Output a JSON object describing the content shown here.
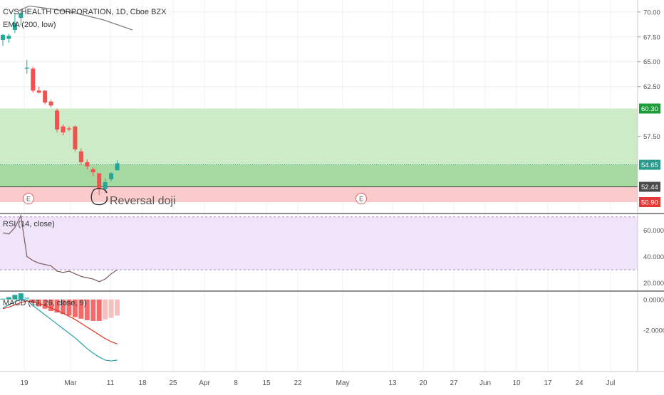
{
  "chart": {
    "title": "CVS HEALTH CORPORATION, 1D, Cboe BZX",
    "ema_label": "EMA (200, low)",
    "annotation": "Reversal doji",
    "earnings_marker": "E",
    "colors": {
      "up": "#26a69a",
      "down": "#ef5350",
      "ema": "#808080",
      "target_zone": "#cdebc6",
      "target_zone_dark": "#a5d9a0",
      "stop_zone": "#fbcaca",
      "price_badge": "#2a9a8c",
      "target_badge": "#1e9c3a",
      "entry_badge": "#4a4a4a",
      "rsi_band": "#f0e4fb",
      "rsi_line": "#7a5a5a",
      "macd_line": "#2aa0a8",
      "signal_line": "#e0321e",
      "hist_strong": "#f26b6b",
      "hist_weak": "#f7c0c0"
    },
    "price_axis": [
      "70.00",
      "67.50",
      "65.00",
      "62.50",
      "57.50"
    ],
    "badges": {
      "target": "60.30",
      "last": "54.65",
      "entry": "52.44",
      "stop": "50.90"
    },
    "rsi": {
      "label": "RSI (14, close)",
      "axis": [
        "60.0000",
        "40.0000",
        "20.0000"
      ]
    },
    "macd": {
      "label": "MACD (12, 26, close, 9)",
      "axis": [
        "0.0000",
        "-2.0000"
      ]
    },
    "x_axis": [
      "19",
      "Mar",
      "11",
      "18",
      "25",
      "Apr",
      "8",
      "15",
      "22",
      "May",
      "13",
      "20",
      "27",
      "Jun",
      "10",
      "17",
      "24",
      "Jul"
    ]
  },
  "chart_data": {
    "type": "candlestick",
    "title": "CVS HEALTH CORPORATION, 1D, Cboe BZX",
    "y_range": [
      49.9,
      71.2
    ],
    "candles": [
      {
        "o": 67.2,
        "h": 67.8,
        "l": 66.6,
        "c": 67.7
      },
      {
        "o": 67.3,
        "h": 67.8,
        "l": 66.9,
        "c": 67.6
      },
      {
        "o": 68.2,
        "h": 69.9,
        "l": 67.9,
        "c": 68.9
      },
      {
        "o": 69.4,
        "h": 70.2,
        "l": 68.6,
        "c": 69.9
      },
      {
        "o": 64.3,
        "h": 65.2,
        "l": 63.8,
        "c": 64.4
      },
      {
        "o": 64.3,
        "h": 64.5,
        "l": 61.9,
        "c": 62.1
      },
      {
        "o": 62.1,
        "h": 62.5,
        "l": 61.8,
        "c": 61.9
      },
      {
        "o": 62.1,
        "h": 62.1,
        "l": 60.7,
        "c": 60.9
      },
      {
        "o": 61.0,
        "h": 61.2,
        "l": 60.4,
        "c": 60.6
      },
      {
        "o": 60.1,
        "h": 60.3,
        "l": 57.9,
        "c": 58.2
      },
      {
        "o": 58.5,
        "h": 58.7,
        "l": 57.6,
        "c": 57.9
      },
      {
        "o": 58.3,
        "h": 58.5,
        "l": 58.0,
        "c": 58.2
      },
      {
        "o": 58.5,
        "h": 58.6,
        "l": 56.0,
        "c": 56.2
      },
      {
        "o": 56.0,
        "h": 56.3,
        "l": 54.6,
        "c": 54.9
      },
      {
        "o": 54.9,
        "h": 55.2,
        "l": 54.2,
        "c": 54.5
      },
      {
        "o": 54.2,
        "h": 54.4,
        "l": 53.5,
        "c": 53.9
      },
      {
        "o": 53.8,
        "h": 53.8,
        "l": 51.6,
        "c": 52.2
      },
      {
        "o": 52.2,
        "h": 53.3,
        "l": 51.8,
        "c": 52.9
      },
      {
        "o": 53.2,
        "h": 53.9,
        "l": 53.0,
        "c": 53.8
      },
      {
        "o": 54.1,
        "h": 55.1,
        "l": 54.1,
        "c": 54.8
      }
    ],
    "ema": {
      "name": "EMA (200, low)",
      "x": [
        0,
        2,
        6,
        10,
        15,
        20
      ],
      "values": [
        70.1,
        70.6,
        70.3,
        69.9,
        69.2,
        68.2
      ]
    },
    "target": 60.3,
    "last": 54.65,
    "entry": 52.44,
    "stop": 50.9,
    "rsi": {
      "name": "RSI (14, close)",
      "y_range": [
        15,
        72
      ],
      "values": [
        58,
        57,
        62,
        71,
        40,
        37,
        35,
        34,
        33,
        29,
        28,
        29,
        27,
        25,
        24,
        23,
        21,
        23,
        27,
        30
      ]
    },
    "macd": {
      "name": "MACD (12, 26, close, 9)",
      "y_range": [
        -4.6,
        0.5
      ],
      "macd": [
        -0.55,
        -0.35,
        -0.15,
        0.0,
        -0.05,
        -0.4,
        -0.7,
        -1.0,
        -1.3,
        -1.6,
        -1.9,
        -2.2,
        -2.5,
        -2.85,
        -3.2,
        -3.5,
        -3.75,
        -3.95,
        -4.0,
        -3.95
      ],
      "signal": [
        -0.6,
        -0.5,
        -0.35,
        -0.2,
        -0.1,
        -0.15,
        -0.25,
        -0.4,
        -0.55,
        -0.72,
        -0.9,
        -1.1,
        -1.3,
        -1.55,
        -1.8,
        -2.05,
        -2.3,
        -2.55,
        -2.75,
        -2.9
      ],
      "histogram": [
        0.05,
        0.15,
        0.3,
        0.4,
        0.15,
        -0.25,
        -0.45,
        -0.6,
        -0.75,
        -0.85,
        -0.95,
        -1.05,
        -1.15,
        -1.25,
        -1.35,
        -1.4,
        -1.4,
        -1.3,
        -1.2,
        -1.05
      ]
    },
    "x_labels": [
      "19",
      "Mar",
      "11",
      "18",
      "25",
      "Apr",
      "8",
      "15",
      "22",
      "May",
      "13",
      "20",
      "27",
      "Jun",
      "10",
      "17",
      "24",
      "Jul"
    ]
  }
}
